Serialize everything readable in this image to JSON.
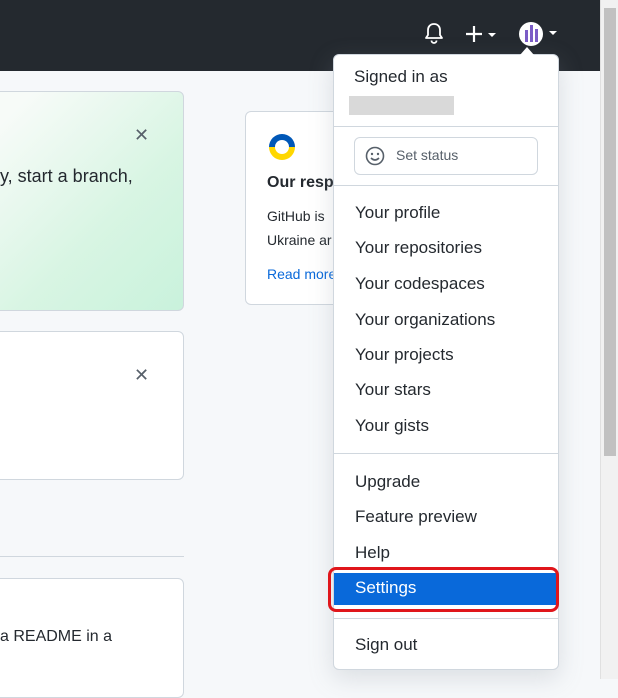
{
  "header": {
    "bell_icon": "bell-icon",
    "plus_icon": "plus-icon",
    "avatar_icon": "avatar-icon",
    "colors": {
      "background": "#24292f",
      "icon": "#ffffff"
    }
  },
  "cards": {
    "card1_text": "y, start a branch,",
    "card3_text": "a README in a",
    "close_glyph": "✕"
  },
  "right_card": {
    "title": "Our resp",
    "line1": "GitHub is",
    "line2": "Ukraine ar",
    "link": "Read more"
  },
  "user_menu": {
    "signed_in_label": "Signed in as",
    "set_status_label": "Set status",
    "section1": [
      "Your profile",
      "Your repositories",
      "Your codespaces",
      "Your organizations",
      "Your projects",
      "Your stars",
      "Your gists"
    ],
    "section2": [
      "Upgrade",
      "Feature preview",
      "Help",
      "Settings"
    ],
    "sign_out": "Sign out",
    "selected_item": "Settings",
    "colors": {
      "selected_bg": "#0969da",
      "highlight_border": "#e0161b"
    }
  }
}
